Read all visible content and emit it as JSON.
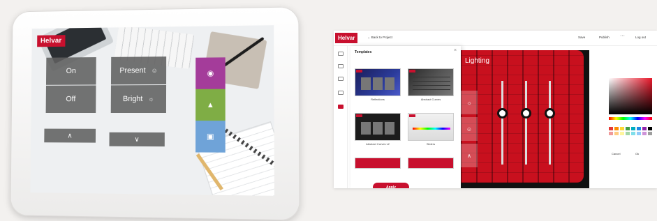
{
  "tablet": {
    "brand": "Helvar",
    "tiles": {
      "on": "On",
      "off": "Off",
      "present": "Present",
      "bright": "Bright",
      "up": "∧",
      "down": "∨"
    }
  },
  "editor": {
    "brand": "Helvar",
    "topbar": {
      "back": "← Back to Project",
      "save": "Save",
      "publish": "Publish",
      "more": "···",
      "logout": "Log out"
    },
    "templates": {
      "title": "Templates",
      "close": "×",
      "items": [
        "Reflections",
        "Abstract Curves",
        "Abstract Curves v2",
        "Sliders"
      ],
      "apply": "Apply"
    },
    "canvas": {
      "title": "Lighting",
      "slider_levels": [
        0.62,
        0.62,
        0.62
      ]
    },
    "properties": {
      "cancel": "Cancel",
      "ok": "Ok"
    },
    "swatch_colors": [
      "#e53935",
      "#fb8c00",
      "#fdd835",
      "#43a047",
      "#00acc1",
      "#1e88e5",
      "#8e24aa",
      "#000000",
      "#ef9a9a",
      "#ffcc80",
      "#fff59d",
      "#a5d6a7",
      "#80deea",
      "#90caf9",
      "#ce93d8",
      "#9e9e9e"
    ],
    "colors": {
      "accent": "#c8102e",
      "canvas": "#c8101e"
    }
  }
}
